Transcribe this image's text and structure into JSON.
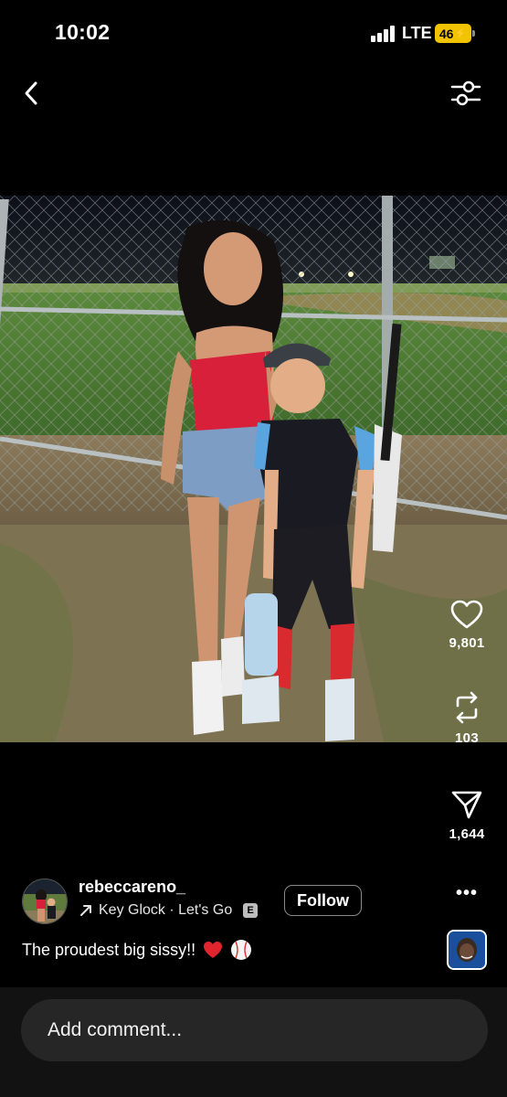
{
  "status_bar": {
    "time": "10:02",
    "network": "LTE",
    "battery": "46"
  },
  "header": {
    "back_icon": "chevron-left-icon",
    "filter_icon": "sliders-icon"
  },
  "post": {
    "actions": {
      "likes": "9,801",
      "reposts": "103",
      "shares": "1,644"
    },
    "author": {
      "username": "rebeccareno_",
      "music": "Key Glock · Let's Go",
      "explicit_badge": "E",
      "follow_label": "Follow"
    },
    "caption": "The proudest big sissy!!",
    "caption_emojis": [
      "heart",
      "baseball"
    ]
  },
  "comment": {
    "placeholder": "Add comment..."
  },
  "colors": {
    "background": "#000000",
    "battery": "#f2c400",
    "comment_bar": "#121212",
    "input": "#262626"
  }
}
